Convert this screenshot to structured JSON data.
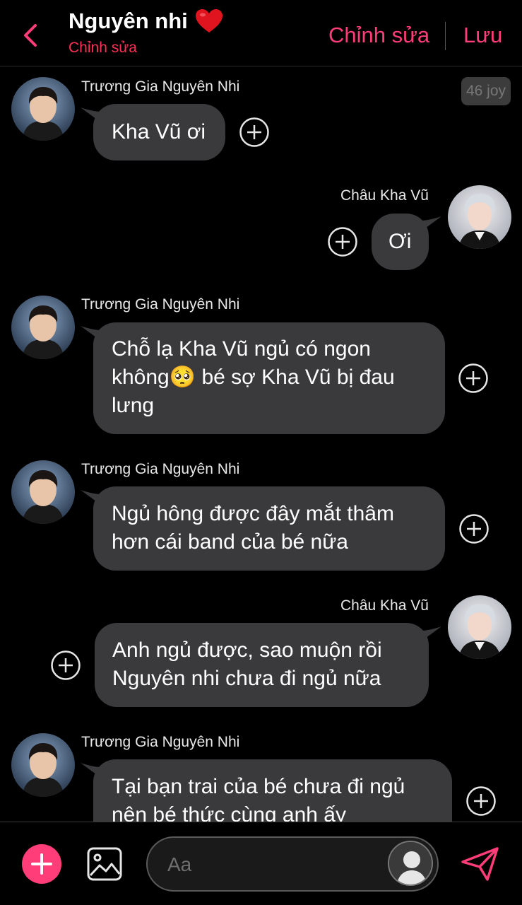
{
  "header": {
    "title": "Nguyên nhi",
    "subtitle": "Chỉnh sửa",
    "edit_label": "Chỉnh sửa",
    "save_label": "Lưu"
  },
  "badge": "46 joy",
  "messages": [
    {
      "sender": "Trương Gia Nguyên Nhi",
      "text": "Kha Vũ ơi"
    },
    {
      "sender": "Châu Kha Vũ",
      "text": "Ơi"
    },
    {
      "sender": "Trương Gia Nguyên Nhi",
      "line1": "Chỗ lạ Kha Vũ ngủ có ngon",
      "line2a": "không",
      "emoji": "🥺",
      "line2b": " bé sợ Kha Vũ bị đau",
      "line3": "lưng"
    },
    {
      "sender": "Trương Gia Nguyên Nhi",
      "line1": "Ngủ hông được đây mắt thâm",
      "line2": "hơn cái band của bé nữa"
    },
    {
      "sender": "Châu Kha Vũ",
      "line1": "Anh ngủ được, sao muộn rồi",
      "line2": "Nguyên nhi chưa đi ngủ nữa"
    },
    {
      "sender": "Trương Gia Nguyên Nhi",
      "line1": "Tại bạn trai của bé chưa đi ngủ",
      "line2": "nên bé thức cùng anh ấy"
    }
  ],
  "composer": {
    "placeholder": "Aa"
  },
  "colors": {
    "accent": "#ff3d79",
    "subtitle": "#ff2f56",
    "bubble": "#3a3a3c",
    "background": "#000000"
  }
}
